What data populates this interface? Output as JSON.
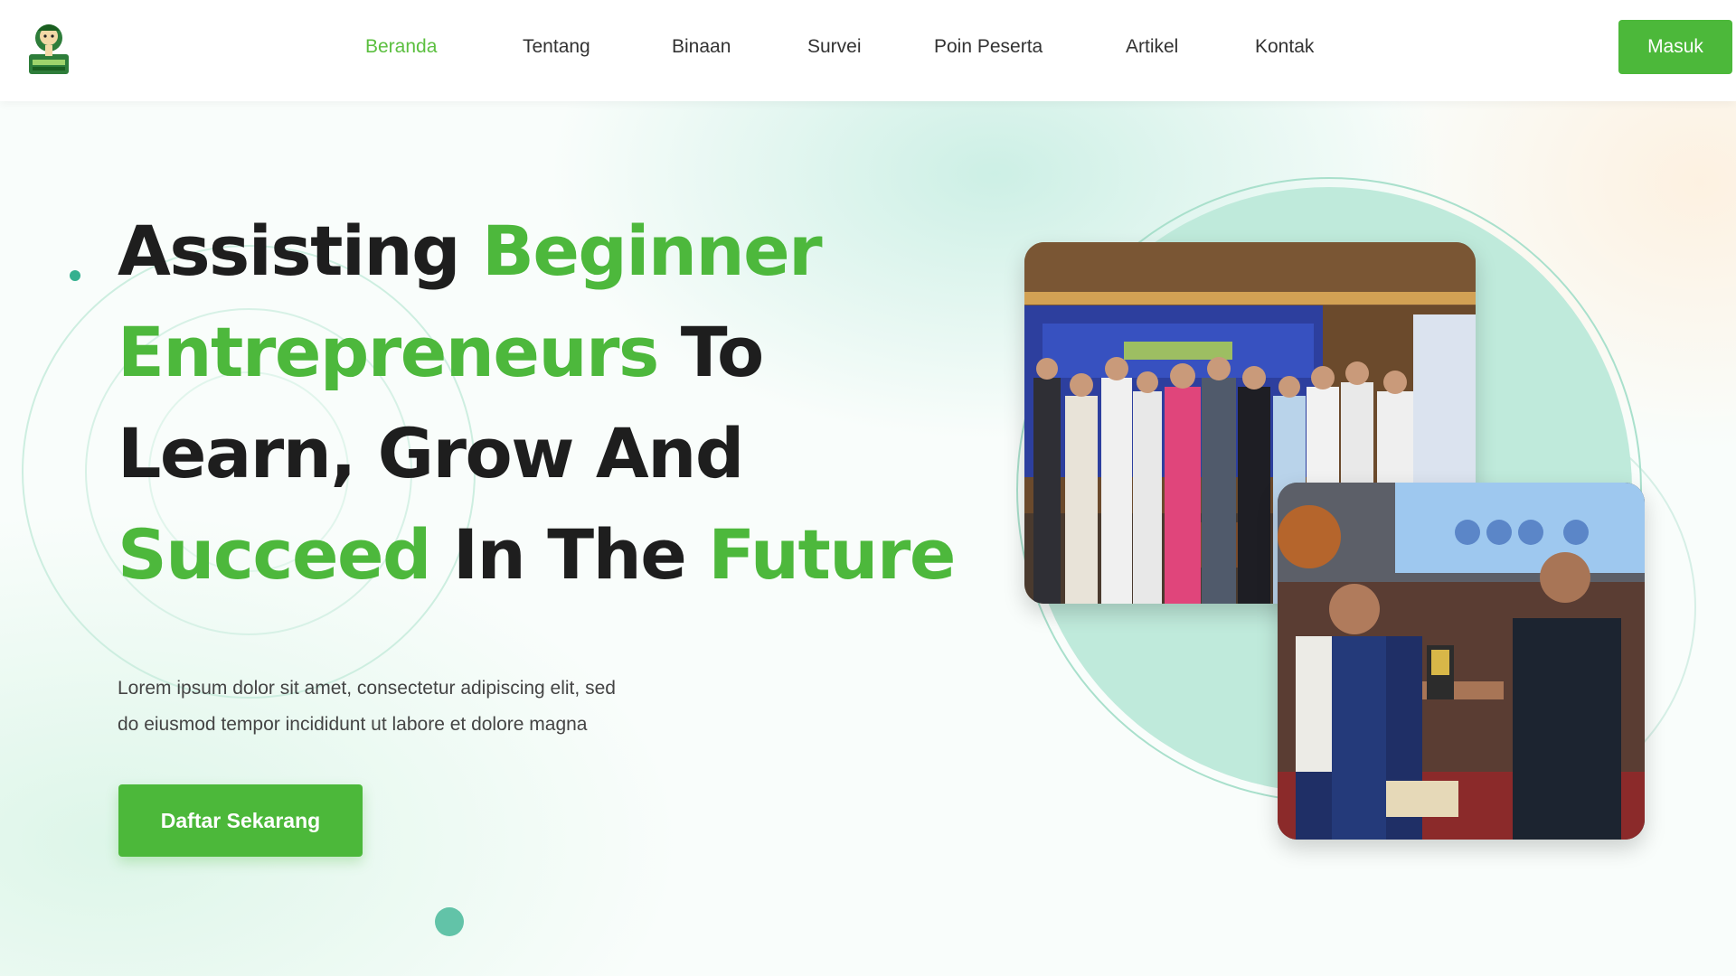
{
  "brand": {
    "logo_icon": "mascot-logo-icon"
  },
  "nav": {
    "items": [
      {
        "label": "Beranda",
        "active": true
      },
      {
        "label": "Tentang",
        "active": false
      },
      {
        "label": "Binaan",
        "active": false
      },
      {
        "label": "Survei",
        "active": false
      },
      {
        "label": "Poin Peserta",
        "active": false
      },
      {
        "label": "Artikel",
        "active": false
      },
      {
        "label": "Kontak",
        "active": false
      }
    ],
    "login_label": "Masuk"
  },
  "hero": {
    "headline": {
      "w1": "Assisting",
      "w2": "Beginner",
      "w3": "Entrepreneurs",
      "w4": "To",
      "w5": "Learn, Grow And",
      "w6": "Succeed",
      "w7": "In The",
      "w8": "Future"
    },
    "description_line1": "Lorem ipsum dolor sit amet, consectetur adipiscing elit, sed",
    "description_line2": "do eiusmod tempor incididunt ut labore et dolore magna",
    "cta_label": "Daftar Sekarang",
    "photo_1": "group-photo-event",
    "photo_2": "award-handover-photo"
  },
  "colors": {
    "accent_green": "#4cb83a",
    "heading_dark": "#1e1e1e",
    "teal_shape": "#bfeadb"
  }
}
